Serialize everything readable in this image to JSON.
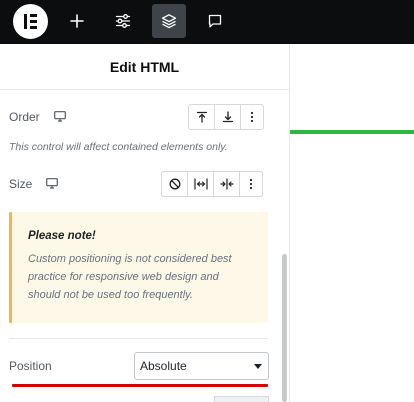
{
  "topbar": {
    "logo_icon": "elementor-logo-icon",
    "buttons": [
      {
        "name": "add-element-button",
        "icon": "plus-icon",
        "active": false
      },
      {
        "name": "site-settings-button",
        "icon": "sliders-icon",
        "active": false
      },
      {
        "name": "structure-button",
        "icon": "layers-icon",
        "active": true
      },
      {
        "name": "notes-button",
        "icon": "comment-icon",
        "active": false
      }
    ]
  },
  "panel": {
    "title": "Edit HTML",
    "order": {
      "label": "Order",
      "device_icon": "desktop-icon",
      "options": [
        "align-top-icon",
        "align-bottom-icon",
        "more-options-icon"
      ]
    },
    "order_helper": "This control will affect contained elements only.",
    "size": {
      "label": "Size",
      "device_icon": "desktop-icon",
      "options": [
        "none-icon",
        "grow-icon",
        "shrink-icon",
        "more-options-icon"
      ]
    },
    "note": {
      "title": "Please note!",
      "body_lines": [
        "Custom positioning is not considered best",
        "practice for responsive web design and",
        "should not be used too frequently."
      ]
    },
    "position": {
      "label": "Position",
      "value": "Absolute"
    }
  },
  "colors": {
    "topbar": "#0c0d0e",
    "note_bg": "#fef8e9",
    "note_border": "#f0b849",
    "red_underline": "#d40404",
    "green_line": "#2bb742"
  }
}
